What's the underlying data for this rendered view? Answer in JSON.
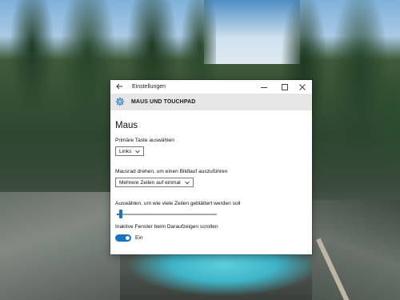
{
  "window": {
    "title": "Einstellungen",
    "section_title": "MAUS UND TOUCHPAD",
    "accent": "#1a72c4"
  },
  "page": {
    "heading": "Maus",
    "primary_button": {
      "label": "Primäre Taste auswählen",
      "value": "Links"
    },
    "wheel_scroll": {
      "label": "Mausrad drehen, um einen Bildlauf auszuführen",
      "value": "Mehrere Zeilen auf einmal"
    },
    "lines_per_scroll": {
      "label": "Auswählen, um wie viele Zeilen geblättert werden soll",
      "fraction": 0.04
    },
    "inactive_scroll": {
      "label": "Inaktive Fenster beim Darauf­zeigen scrollen",
      "state": "Ein",
      "on": true
    }
  },
  "icons": {
    "back": "back-arrow-icon",
    "minimize": "minimize-icon",
    "maximize": "maximize-icon",
    "close": "close-icon",
    "settings": "gear-icon",
    "dropdown": "chevron-down-icon"
  }
}
